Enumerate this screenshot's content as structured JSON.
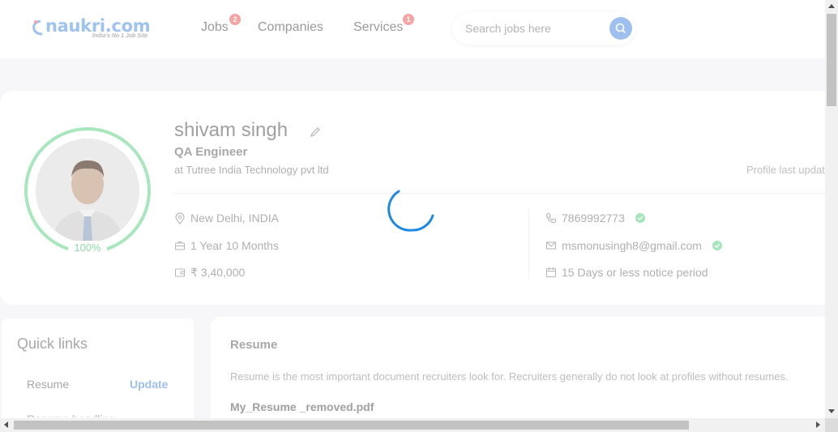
{
  "header": {
    "logo": {
      "text": "naukri.com",
      "tagline": "India's No 1 Job Site"
    },
    "nav": [
      {
        "label": "Jobs",
        "badge": "2"
      },
      {
        "label": "Companies"
      },
      {
        "label": "Services",
        "badge": "1"
      }
    ],
    "search": {
      "placeholder": "Search jobs here"
    }
  },
  "profile": {
    "name": "shivam singh",
    "role": "QA Engineer",
    "company": "at Tutree India Technology pvt ltd",
    "last_updated_label": "Profile last updated",
    "completion": "100%",
    "location": "New Delhi, INDIA",
    "experience": "1 Year 10 Months",
    "salary": "₹ 3,40,000",
    "phone": "7869992773",
    "email": "msmonusingh8@gmail.com",
    "notice_period": "15 Days or less notice period"
  },
  "quick_links": {
    "title": "Quick links",
    "items": [
      {
        "label": "Resume",
        "action": "Update"
      },
      {
        "label": "Resume headline"
      }
    ]
  },
  "resume": {
    "title": "Resume",
    "description": "Resume is the most important document recruiters look for. Recruiters generally do not look at profiles without resumes.",
    "file_name": "My_Resume _removed.pdf"
  },
  "colors": {
    "brand_blue": "#9ec0ee",
    "verified_green": "#a6e4bb",
    "badge_red": "#f5a3a3",
    "spinner_blue": "#1e88e5"
  }
}
